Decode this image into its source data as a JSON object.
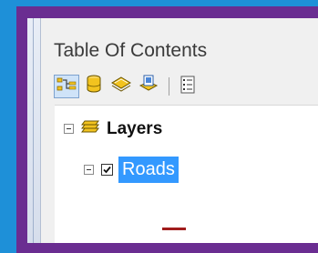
{
  "panel": {
    "title": "Table Of Contents"
  },
  "toolbar": {
    "buttons": [
      {
        "name": "list-by-drawing-order-icon"
      },
      {
        "name": "list-by-source-icon"
      },
      {
        "name": "list-by-visibility-icon"
      },
      {
        "name": "list-by-selection-icon"
      },
      {
        "name": "options-icon"
      }
    ]
  },
  "tree": {
    "root_label": "Layers",
    "child_label": "Roads",
    "child_checked": true
  },
  "colors": {
    "background": "#1e90d8",
    "frame": "#6a2d91",
    "selection": "#3399ff",
    "road_symbol": "#a01c1c"
  }
}
